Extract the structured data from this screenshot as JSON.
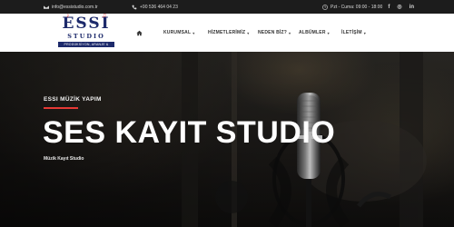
{
  "topbar": {
    "email": "info@essistudio.com.tr",
    "phone": "+90 536 464 04 23",
    "hours": "Pzt - Cuma: 09:00 - 18:00",
    "social": [
      {
        "icon": "facebook-icon",
        "label": "f"
      },
      {
        "icon": "instagram-icon",
        "label": "◎"
      },
      {
        "icon": "linkedin-icon",
        "label": "in"
      }
    ]
  },
  "logo": {
    "word": "ESSI",
    "studio": "STUDIO",
    "tagline": "PRODÜKSİYON, ARANJE & MASTERİNG"
  },
  "menu": {
    "items": [
      {
        "label": "KURUMSAL",
        "caret": "▾"
      },
      {
        "label": "HİZMETLERİMİZ",
        "caret": "▾"
      },
      {
        "label": "NEDEN BİZ?",
        "caret": "▾"
      },
      {
        "label": "ALBÜMLER",
        "caret": "▾"
      },
      {
        "label": "İLETİŞİM",
        "caret": "▾"
      }
    ]
  },
  "hero": {
    "eyebrow": "ESSI MÜZİK YAPIM",
    "title": "SES KAYIT STUDIO",
    "subtitle": "Müzik Kayıt Studio"
  },
  "colors": {
    "accent": "#e53935",
    "brand": "#1d2a6b",
    "topbar": "#1c1c1c"
  }
}
